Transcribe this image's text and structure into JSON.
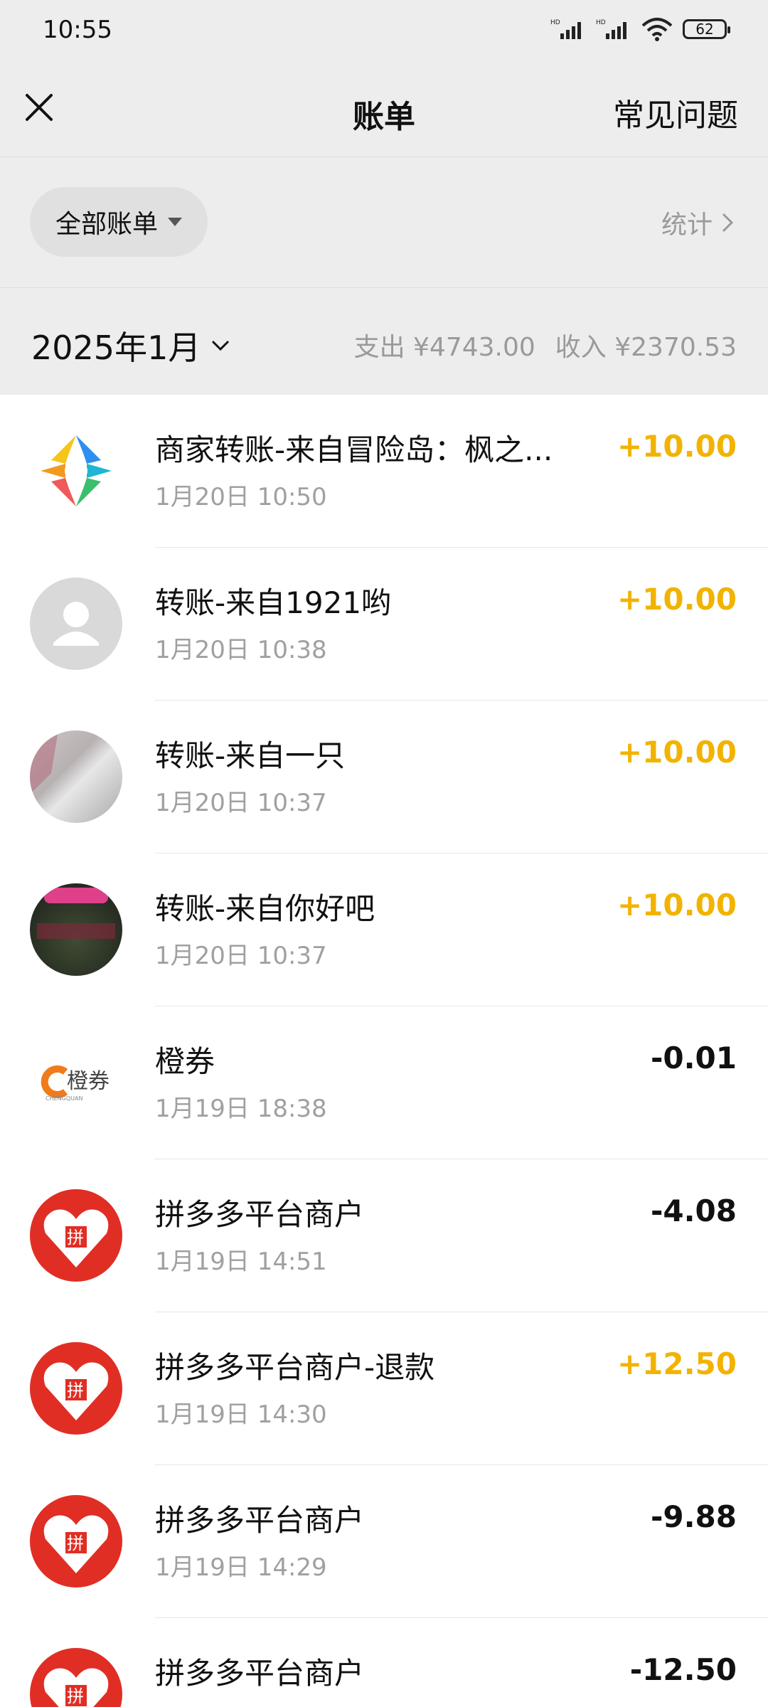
{
  "status_bar": {
    "time": "10:55",
    "battery": "62"
  },
  "header": {
    "title": "账单",
    "faq_label": "常见问题"
  },
  "filter": {
    "label": "全部账单",
    "stats_label": "统计"
  },
  "month_summary": {
    "month": "2025年1月",
    "expense": "支出 ¥4743.00",
    "income": "收入 ¥2370.53"
  },
  "transactions": [
    {
      "title": "商家转账-来自冒险岛：枫之...",
      "date": "1月20日 10:50",
      "amount": "+10.00",
      "type": "income",
      "avatar": "maplestory-logo"
    },
    {
      "title": "转账-来自1921哟",
      "date": "1月20日 10:38",
      "amount": "+10.00",
      "type": "income",
      "avatar": "default-user"
    },
    {
      "title": "转账-来自一只",
      "date": "1月20日 10:37",
      "amount": "+10.00",
      "type": "income",
      "avatar": "photo"
    },
    {
      "title": "转账-来自你好吧",
      "date": "1月20日 10:37",
      "amount": "+10.00",
      "type": "income",
      "avatar": "photo-dark"
    },
    {
      "title": "橙券",
      "date": "1月19日 18:38",
      "amount": "-0.01",
      "type": "expense",
      "avatar": "chengquan-logo",
      "logo_text": "橙券",
      "logo_sub": "CHENGQUAN"
    },
    {
      "title": "拼多多平台商户",
      "date": "1月19日 14:51",
      "amount": "-4.08",
      "type": "expense",
      "avatar": "pinduoduo-logo"
    },
    {
      "title": "拼多多平台商户-退款",
      "date": "1月19日 14:30",
      "amount": "+12.50",
      "type": "income",
      "avatar": "pinduoduo-logo"
    },
    {
      "title": "拼多多平台商户",
      "date": "1月19日 14:29",
      "amount": "-9.88",
      "type": "expense",
      "avatar": "pinduoduo-logo"
    },
    {
      "title": "拼多多平台商户",
      "date": "",
      "amount": "-12.50",
      "type": "expense",
      "avatar": "pinduoduo-logo"
    }
  ],
  "colors": {
    "income": "#f2b300",
    "expense": "#111111",
    "background": "#ededed",
    "pinduoduo_red": "#e02e24"
  }
}
